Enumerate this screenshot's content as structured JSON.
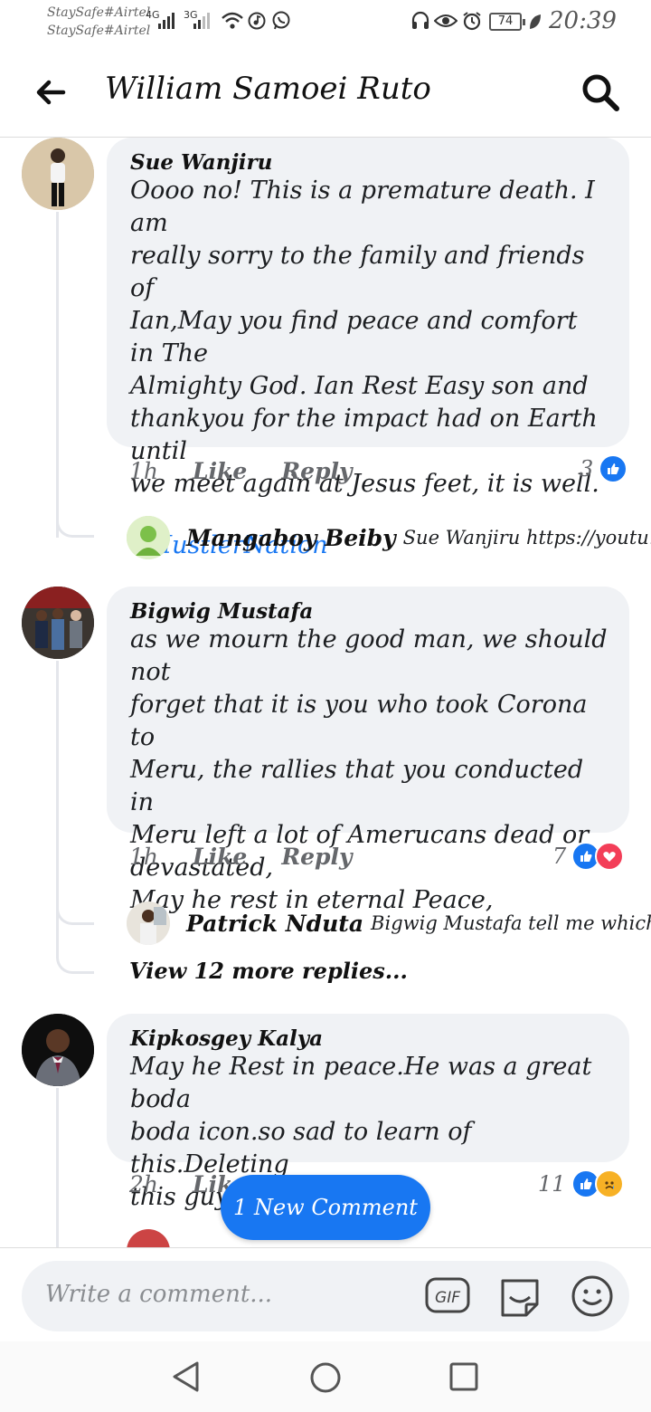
{
  "status_bar": {
    "carrier_1": "StaySafe#Airtel",
    "carrier_2": "StaySafe#Airtel",
    "network_1": "4G",
    "network_2": "3G",
    "battery": "74",
    "time": "20:39"
  },
  "header": {
    "title": "William Samoei Ruto",
    "back_icon": "arrow-left-icon",
    "search_icon": "search-icon"
  },
  "comments": [
    {
      "author": "Sue Wanjiru",
      "text": "Oooo no! This is a premature death. I am\nreally sorry to the family and friends of\nIan,May you find peace and comfort in The\nAlmighty God. Ian Rest Easy son and\nthankyou for the impact had on Earth until\nwe meet again at Jesus feet, it is well.",
      "hashtag": "#HustlerNation",
      "time": "1h",
      "like_label": "Like",
      "reply_label": "Reply",
      "reaction_count": "3",
      "reply": {
        "author": "Mangaboy Beiby",
        "snippet": "Sue Wanjiru https://youtu...."
      }
    },
    {
      "author": "Bigwig Mustafa",
      "text": "as we mourn the good man, we should not\nforget that it is you who took Corona to\nMeru, the rallies that you conducted in\nMeru left a lot of Amerucans dead or\ndevastated,\nMay he rest in eternal Peace,",
      "time": "1h",
      "like_label": "Like",
      "reply_label": "Reply",
      "reaction_count": "7",
      "reply": {
        "author": "Patrick Nduta",
        "snippet": "Bigwig Mustafa tell me which c..."
      },
      "more_replies": "View 12 more replies..."
    },
    {
      "author": "Kipkosgey Kalya",
      "text": "May he Rest in peace.He was a great boda\nboda icon.so sad to learn of this.Deleting\nthis guy's no is hard.😥",
      "time": "2h",
      "like_label": "Like",
      "reaction_count": "11"
    }
  ],
  "new_comment_pill": "1 New Comment",
  "composer": {
    "placeholder": "Write a comment...",
    "gif_label": "GIF"
  },
  "colors": {
    "accent": "#1877f2",
    "bubble": "#f0f2f5",
    "love": "#f33e58"
  }
}
